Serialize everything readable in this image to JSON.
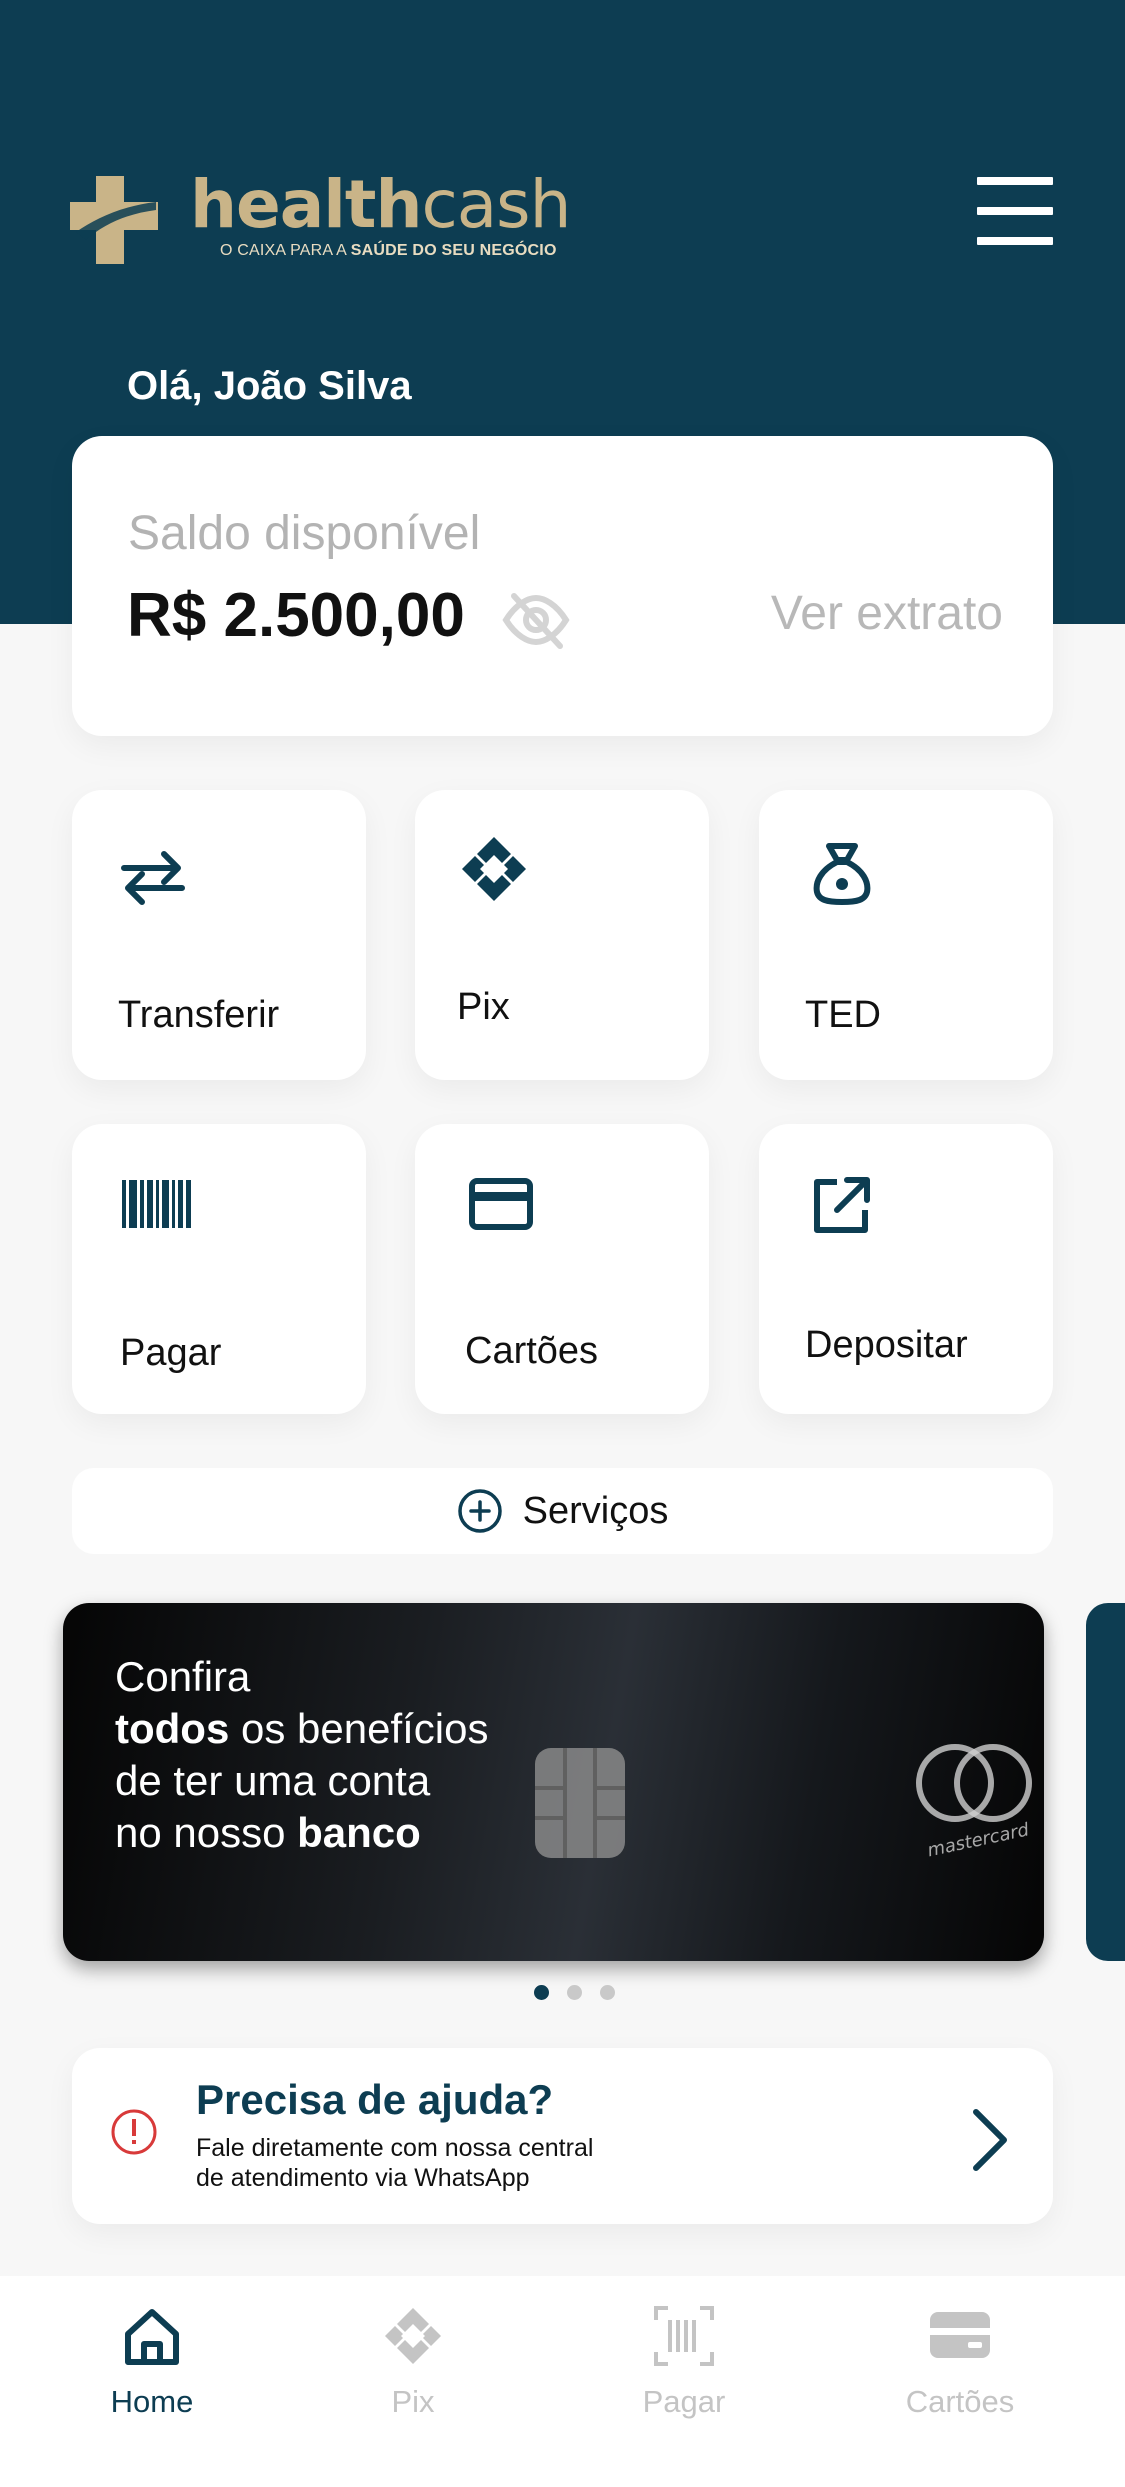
{
  "brand": {
    "name_bold": "health",
    "name_light": "cash",
    "tagline_regular": "O CAIXA PARA A",
    "tagline_bold": "SAÚDE DO SEU NEGÓCIO",
    "color_primary": "#0d3d52",
    "color_gold": "#c9b488"
  },
  "header": {
    "greeting": "Olá, João Silva"
  },
  "balance": {
    "label": "Saldo disponível",
    "value": "R$ 2.500,00",
    "statement_link": "Ver extrato"
  },
  "actions": [
    {
      "label": "Transferir",
      "icon": "transfer-arrows-icon"
    },
    {
      "label": "Pix",
      "icon": "pix-icon"
    },
    {
      "label": "TED",
      "icon": "money-bag-icon"
    },
    {
      "label": "Pagar",
      "icon": "barcode-icon"
    },
    {
      "label": "Cartões",
      "icon": "credit-card-icon"
    },
    {
      "label": "Depositar",
      "icon": "external-link-icon"
    }
  ],
  "services": {
    "label": "Serviços",
    "icon": "plus-circle-icon"
  },
  "banner": {
    "line1": "Confira",
    "line2_bold": "todos",
    "line2_rest": " os benefícios",
    "line3": "de ter uma conta",
    "line4_start": "no nosso ",
    "line4_bold": "banco",
    "card_brand": "mastercard",
    "page_count": 3,
    "active_page": 1
  },
  "help": {
    "title": "Precisa de ajuda?",
    "desc_line1": "Fale diretamente com nossa central",
    "desc_line2": "de atendimento via WhatsApp"
  },
  "tabbar": {
    "items": [
      {
        "label": "Home",
        "icon": "home-icon",
        "active": true
      },
      {
        "label": "Pix",
        "icon": "pix-icon",
        "active": false
      },
      {
        "label": "Pagar",
        "icon": "barcode-scan-icon",
        "active": false
      },
      {
        "label": "Cartões",
        "icon": "credit-card-icon",
        "active": false
      }
    ]
  }
}
